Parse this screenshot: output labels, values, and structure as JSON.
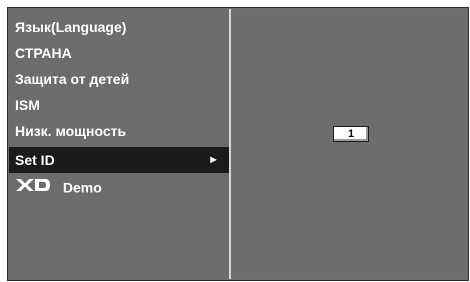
{
  "menu": {
    "items": [
      {
        "label": "Язык(Language)"
      },
      {
        "label": "СТРАНА"
      },
      {
        "label": "Защита от детей"
      },
      {
        "label": "ISM"
      },
      {
        "label": "Низк. мощность"
      },
      {
        "label": "Set ID",
        "selected": true
      },
      {
        "label": "Demo",
        "logo": "XD"
      }
    ],
    "selected_arrow": "►"
  },
  "set_id": {
    "value": "1"
  }
}
